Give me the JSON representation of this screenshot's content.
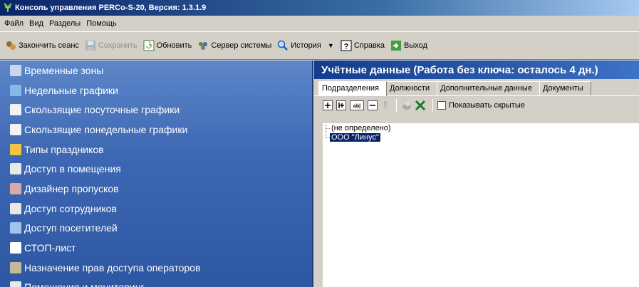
{
  "window": {
    "title": "Консоль управления PERCo-S-20, Версия: 1.3.1.9",
    "icon": "perco-app-icon"
  },
  "menubar": {
    "items": [
      "Файл",
      "Вид",
      "Разделы",
      "Помощь"
    ]
  },
  "toolbar": {
    "buttons": [
      {
        "label": "Закончить сеанс",
        "icon": "end-session-icon",
        "enabled": true
      },
      {
        "label": "Сохранить",
        "icon": "save-icon",
        "enabled": false
      },
      {
        "label": "Обновить",
        "icon": "refresh-icon",
        "enabled": true
      },
      {
        "label": "Сервер системы",
        "icon": "server-icon",
        "enabled": true
      },
      {
        "label": "История",
        "icon": "history-icon",
        "enabled": true
      },
      {
        "label": "Справка",
        "icon": "help-icon",
        "enabled": true
      },
      {
        "label": "Выход",
        "icon": "exit-icon",
        "enabled": true
      }
    ]
  },
  "sidebar": {
    "items": [
      {
        "label": "Временные зоны",
        "icon": "time-zones-icon",
        "color": "#c9d7ea"
      },
      {
        "label": "Недельные графики",
        "icon": "weekly-schedule-icon",
        "color": "#86b7e8"
      },
      {
        "label": "Скользящие посуточные графики",
        "icon": "daily-schedule-icon",
        "color": "#f2f2f2"
      },
      {
        "label": "Скользящие понедельные графики",
        "icon": "weekly-rolling-icon",
        "color": "#f2f2f2"
      },
      {
        "label": "Типы праздников",
        "icon": "holidays-icon",
        "color": "#f4c542"
      },
      {
        "label": "Доступ в помещения",
        "icon": "premises-access-icon",
        "color": "#e8e8e8"
      },
      {
        "label": "Дизайнер пропусков",
        "icon": "pass-designer-icon",
        "color": "#d9a8a8"
      },
      {
        "label": "Доступ сотрудников",
        "icon": "employee-access-icon",
        "color": "#e8e8e8"
      },
      {
        "label": "Доступ посетителей",
        "icon": "visitor-access-icon",
        "color": "#9fc4ee"
      },
      {
        "label": "СТОП-лист",
        "icon": "stop-list-icon",
        "color": "#ffffff"
      },
      {
        "label": "Назначение прав доступа операторов",
        "icon": "operator-rights-icon",
        "color": "#c8b89a"
      },
      {
        "label": "Помещения и мониторинг",
        "icon": "premises-monitoring-icon",
        "color": "#e8e8e8"
      }
    ]
  },
  "main": {
    "title": "Учётные данные (Работа без ключа: осталось 4 дн.)",
    "tabs": [
      "Подразделения",
      "Должности",
      "Дополнительные данные",
      "Документы"
    ],
    "active_tab": 0,
    "subtoolbar": {
      "icons": [
        "add-node-icon",
        "add-child-icon",
        "rename-icon",
        "delete-icon",
        "move-icon",
        "find-icon",
        "excel-export-icon"
      ],
      "show_hidden_label": "Показывать скрытые",
      "show_hidden_checked": false
    },
    "tree": [
      {
        "label": "(не определено)",
        "selected": false
      },
      {
        "label": "ООО \"Линус\"",
        "selected": true
      }
    ]
  },
  "colors": {
    "sidebar_top": "#5d87c9",
    "sidebar_bottom": "#2d57a2",
    "title_accent": "#0a246a",
    "panel_title": "#123d8f"
  }
}
